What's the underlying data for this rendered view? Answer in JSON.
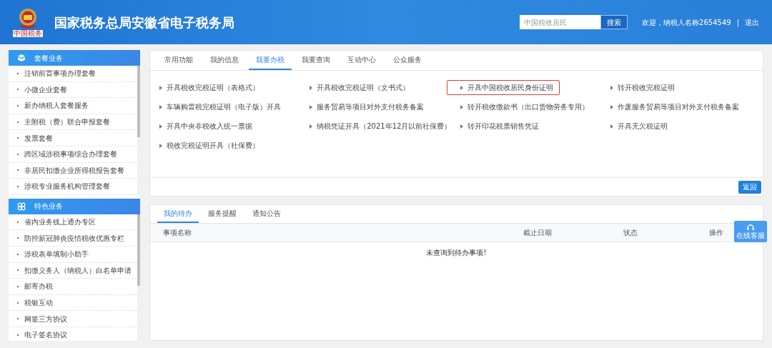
{
  "header": {
    "title": "国家税务总局安徽省电子税务局",
    "logo_caption": "中国税务",
    "search": {
      "placeholder": "中国税收居民",
      "button": "搜索"
    },
    "welcome": "欢迎，纳税人名称2654549",
    "separator": "|",
    "logout": "退出"
  },
  "sidebar": [
    {
      "title": "套餐业务",
      "kind": "cube",
      "items": [
        "注销前置事项办理套餐",
        "小微企业套餐",
        "新办纳税人套餐服务",
        "主附税（费）联合申报套餐",
        "发票套餐",
        "跨区域涉税事项综合办理套餐",
        "非居民扣缴企业所得税报告套餐",
        "涉税专业服务机构管理套餐"
      ]
    },
    {
      "title": "特色业务",
      "kind": "grid",
      "items": [
        "省内业务线上通办专区",
        "防控新冠肺炎疫情税收优惠专栏",
        "涉税表单填制小助手",
        "扣缴义务人（纳税人）白名单申请",
        "邮寄办税",
        "税银互动",
        "网签三方协议",
        "电子签名协议"
      ]
    }
  ],
  "main_tabs": [
    {
      "label": "常用功能",
      "selected": false
    },
    {
      "label": "我的信息",
      "selected": false
    },
    {
      "label": "我要办税",
      "selected": true
    },
    {
      "label": "我要查询",
      "selected": false
    },
    {
      "label": "互动中心",
      "selected": false
    },
    {
      "label": "公众服务",
      "selected": false
    }
  ],
  "services": [
    {
      "label": "开具税收完税证明（表格式）",
      "highlighted": false
    },
    {
      "label": "开具税收完税证明（文书式）",
      "highlighted": false
    },
    {
      "label": "开具中国税收居民身份证明",
      "highlighted": true
    },
    {
      "label": "转开税收完税证明",
      "highlighted": false
    },
    {
      "label": "车辆购置税完税证明（电子版）开具",
      "highlighted": false
    },
    {
      "label": "服务贸易等项目对外支付税务备案",
      "highlighted": false
    },
    {
      "label": "转开税收缴款书（出口货物劳务专用）",
      "highlighted": false
    },
    {
      "label": "作废服务贸易等项目对外支付税务备案",
      "highlighted": false
    },
    {
      "label": "开具中央非税收入统一票据",
      "highlighted": false
    },
    {
      "label": "纳税凭证开具（2021年12月以前社保费）",
      "highlighted": false
    },
    {
      "label": "转开印花税票销售凭证",
      "highlighted": false
    },
    {
      "label": "开具无欠税证明",
      "highlighted": false
    },
    {
      "label": "税收完税证明开具（社保费）",
      "highlighted": false
    }
  ],
  "back_button": "返回",
  "todo_tabs": [
    {
      "label": "我的待办",
      "selected": true
    },
    {
      "label": "服务提醒",
      "selected": false
    },
    {
      "label": "通知公告",
      "selected": false
    }
  ],
  "todo_table": {
    "columns": [
      "事项名称",
      "截止日期",
      "状态",
      "操作"
    ],
    "empty_message": "未查询到待办事项!"
  },
  "float_button": "在线客服"
}
